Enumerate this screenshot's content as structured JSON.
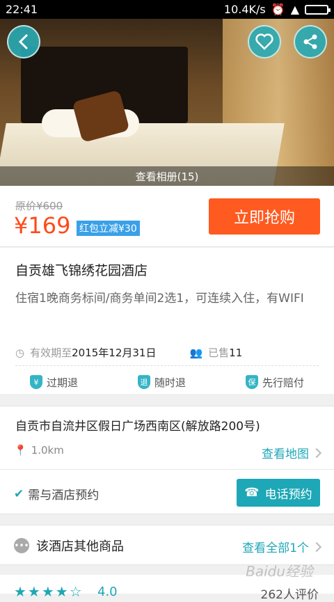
{
  "status_bar": {
    "time": "22:41",
    "speed": "10.4K/s"
  },
  "hero": {
    "album_label": "查看相册(15)"
  },
  "pricing": {
    "original": "原价¥600",
    "price": "¥169",
    "promo": "红包立减¥30",
    "buy_button": "立即抢购"
  },
  "info": {
    "hotel_name": "自贡雄飞锦绣花园酒店",
    "description": "住宿1晚商务标间/商务单间2选1，可连续入住，有WIFI",
    "validity_prefix": "有效期至",
    "validity_date": "2015年12月31日",
    "sold_prefix": "已售",
    "sold_count": "11",
    "guarantees": [
      {
        "icon": "¥",
        "label": "过期退"
      },
      {
        "icon": "退",
        "label": "随时退"
      },
      {
        "icon": "保",
        "label": "先行赔付"
      }
    ]
  },
  "location": {
    "address": "自贡市自流井区假日广场西南区(解放路200号)",
    "distance": "1.0km",
    "map_link": "查看地图",
    "reservation_note": "需与酒店预约",
    "call_button": "电话预约"
  },
  "other": {
    "title": "该酒店其他商品",
    "view_all": "查看全部1个"
  },
  "rating": {
    "stars": "★★★★☆",
    "score": "4.0",
    "reviews": "262人评价"
  },
  "watermark": "Baidu经验"
}
